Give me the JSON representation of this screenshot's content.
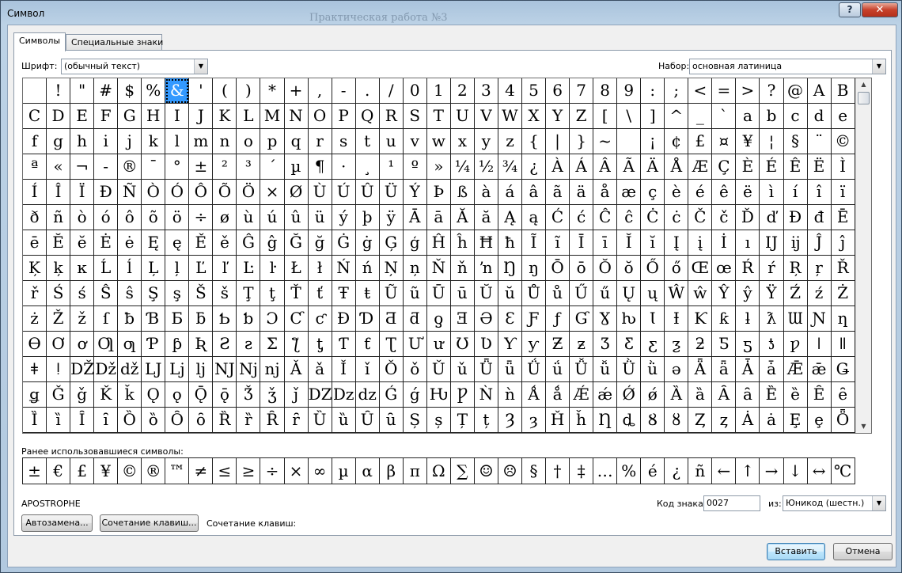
{
  "window": {
    "title": "Символ",
    "background_title": "Практическая работа №3",
    "help": "?",
    "close": "✕"
  },
  "tabs": [
    {
      "label": "Символы"
    },
    {
      "label": "Специальные знаки"
    }
  ],
  "font": {
    "label": "Шрифт:",
    "value": "(обычный текст)"
  },
  "subset": {
    "label": "Набор:",
    "value": "основная латиница"
  },
  "grid": {
    "selected_index": 6,
    "rows": [
      [
        " ",
        "!",
        "\"",
        "#",
        "$",
        "%",
        "&",
        "'",
        "(",
        ")",
        "*",
        "+",
        ",",
        "-",
        ".",
        "/",
        "0",
        "1",
        "2",
        "3",
        "4",
        "5",
        "6",
        "7",
        "8",
        "9",
        ":",
        ";",
        "<",
        "=",
        ">",
        "?",
        "@",
        "A",
        "B"
      ],
      [
        "C",
        "D",
        "E",
        "F",
        "G",
        "H",
        "I",
        "J",
        "K",
        "L",
        "M",
        "N",
        "O",
        "P",
        "Q",
        "R",
        "S",
        "T",
        "U",
        "V",
        "W",
        "X",
        "Y",
        "Z",
        "[",
        "\\",
        "]",
        "^",
        "_",
        "`",
        "a",
        "b",
        "c",
        "d",
        "e"
      ],
      [
        "f",
        "g",
        "h",
        "i",
        "j",
        "k",
        "l",
        "m",
        "n",
        "o",
        "p",
        "q",
        "r",
        "s",
        "t",
        "u",
        "v",
        "w",
        "x",
        "y",
        "z",
        "{",
        "|",
        "}",
        "~",
        " ",
        "¡",
        "¢",
        "£",
        "¤",
        "¥",
        "¦",
        "§",
        "¨",
        "©"
      ],
      [
        "ª",
        "«",
        "¬",
        "-",
        "®",
        "¯",
        "°",
        "±",
        "²",
        "³",
        "´",
        "µ",
        "¶",
        "·",
        "¸",
        "¹",
        "º",
        "»",
        "¼",
        "½",
        "¾",
        "¿",
        "À",
        "Á",
        "Â",
        "Ã",
        "Ä",
        "Å",
        "Æ",
        "Ç",
        "È",
        "É",
        "Ê",
        "Ë",
        "Ì"
      ],
      [
        "Í",
        "Î",
        "Ï",
        "Ð",
        "Ñ",
        "Ò",
        "Ó",
        "Ô",
        "Õ",
        "Ö",
        "×",
        "Ø",
        "Ù",
        "Ú",
        "Û",
        "Ü",
        "Ý",
        "Þ",
        "ß",
        "à",
        "á",
        "â",
        "ã",
        "ä",
        "å",
        "æ",
        "ç",
        "è",
        "é",
        "ê",
        "ë",
        "ì",
        "í",
        "î",
        "ï"
      ],
      [
        "ð",
        "ñ",
        "ò",
        "ó",
        "ô",
        "õ",
        "ö",
        "÷",
        "ø",
        "ù",
        "ú",
        "û",
        "ü",
        "ý",
        "þ",
        "ÿ",
        "Ā",
        "ā",
        "Ă",
        "ă",
        "Ą",
        "ą",
        "Ć",
        "ć",
        "Ĉ",
        "ĉ",
        "Ċ",
        "ċ",
        "Č",
        "č",
        "Ď",
        "ď",
        "Đ",
        "đ",
        "Ē"
      ],
      [
        "ē",
        "Ĕ",
        "ĕ",
        "Ė",
        "ė",
        "Ę",
        "ę",
        "Ě",
        "ě",
        "Ĝ",
        "ĝ",
        "Ğ",
        "ğ",
        "Ġ",
        "ġ",
        "Ģ",
        "ģ",
        "Ĥ",
        "ĥ",
        "Ħ",
        "ħ",
        "Ĩ",
        "ĩ",
        "Ī",
        "ī",
        "Ĭ",
        "ĭ",
        "Į",
        "į",
        "İ",
        "ı",
        "Ĳ",
        "ĳ",
        "Ĵ",
        "ĵ"
      ],
      [
        "Ķ",
        "ķ",
        "ĸ",
        "Ĺ",
        "ĺ",
        "Ļ",
        "ļ",
        "Ľ",
        "ľ",
        "Ŀ",
        "ŀ",
        "Ł",
        "ł",
        "Ń",
        "ń",
        "Ņ",
        "ņ",
        "Ň",
        "ň",
        "ŉ",
        "Ŋ",
        "ŋ",
        "Ō",
        "ō",
        "Ŏ",
        "ŏ",
        "Ő",
        "ő",
        "Œ",
        "œ",
        "Ŕ",
        "ŕ",
        "Ŗ",
        "ŗ",
        "Ř"
      ],
      [
        "ř",
        "Ś",
        "ś",
        "Ŝ",
        "ŝ",
        "Ş",
        "ş",
        "Š",
        "š",
        "Ţ",
        "ţ",
        "Ť",
        "ť",
        "Ŧ",
        "ŧ",
        "Ũ",
        "ũ",
        "Ū",
        "ū",
        "Ŭ",
        "ŭ",
        "Ů",
        "ů",
        "Ű",
        "ű",
        "Ų",
        "ų",
        "Ŵ",
        "ŵ",
        "Ŷ",
        "ŷ",
        "Ÿ",
        "Ź",
        "ź",
        "Ż"
      ],
      [
        "ż",
        "Ž",
        "ž",
        "ſ",
        "ƀ",
        "Ɓ",
        "Ƃ",
        "ƃ",
        "Ƅ",
        "ƅ",
        "Ɔ",
        "Ƈ",
        "ƈ",
        "Ɖ",
        "Ɗ",
        "Ƌ",
        "ƌ",
        "ƍ",
        "Ǝ",
        "Ə",
        "Ɛ",
        "Ƒ",
        "ƒ",
        "Ɠ",
        "Ɣ",
        "ƕ",
        "Ɩ",
        "Ɨ",
        "Ƙ",
        "ƙ",
        "ƚ",
        "ƛ",
        "Ɯ",
        "Ɲ",
        "ƞ"
      ],
      [
        "Ɵ",
        "Ơ",
        "ơ",
        "Ƣ",
        "ƣ",
        "Ƥ",
        "ƥ",
        "Ʀ",
        "Ƨ",
        "ƨ",
        "Ʃ",
        "ƪ",
        "ƫ",
        "Ƭ",
        "ƭ",
        "Ʈ",
        "Ư",
        "ư",
        "Ʊ",
        "Ʋ",
        "Ƴ",
        "ƴ",
        "Ƶ",
        "ƶ",
        "Ʒ",
        "Ƹ",
        "ƹ",
        "ƺ",
        "ƻ",
        "Ƽ",
        "ƽ",
        "ƾ",
        "ƿ",
        "ǀ",
        "ǁ"
      ],
      [
        "ǂ",
        "ǃ",
        "Ǆ",
        "ǅ",
        "ǆ",
        "Ǉ",
        "ǈ",
        "ǉ",
        "Ǌ",
        "ǋ",
        "ǌ",
        "Ǎ",
        "ǎ",
        "Ǐ",
        "ǐ",
        "Ǒ",
        "ǒ",
        "Ǔ",
        "ǔ",
        "Ǖ",
        "ǖ",
        "Ǘ",
        "ǘ",
        "Ǚ",
        "ǚ",
        "Ǜ",
        "ǜ",
        "ǝ",
        "Ǟ",
        "ǟ",
        "Ǡ",
        "ǡ",
        "Ǣ",
        "ǣ",
        "Ǥ"
      ],
      [
        "ǥ",
        "Ǧ",
        "ǧ",
        "Ǩ",
        "ǩ",
        "Ǫ",
        "ǫ",
        "Ǭ",
        "ǭ",
        "Ǯ",
        "ǯ",
        "ǰ",
        "Ǳ",
        "ǲ",
        "ǳ",
        "Ǵ",
        "ǵ",
        "Ƕ",
        "Ƿ",
        "Ǹ",
        "ǹ",
        "Ǻ",
        "ǻ",
        "Ǽ",
        "ǽ",
        "Ǿ",
        "ǿ",
        "Ȁ",
        "ȁ",
        "Ȃ",
        "ȃ",
        "Ȅ",
        "ȅ",
        "Ȇ",
        "ȇ"
      ],
      [
        "Ȉ",
        "ȉ",
        "Ȋ",
        "ȋ",
        "Ȍ",
        "ȍ",
        "Ȏ",
        "ȏ",
        "Ȑ",
        "ȑ",
        "Ȓ",
        "ȓ",
        "Ȕ",
        "ȕ",
        "Ȗ",
        "ȗ",
        "Ș",
        "ș",
        "Ț",
        "ț",
        "Ȝ",
        "ȝ",
        "Ȟ",
        "ȟ",
        "Ƞ",
        "ȡ",
        "Ȣ",
        "ȣ",
        "Ȥ",
        "ȥ",
        "Ȧ",
        "ȧ",
        "Ȩ",
        "ȩ",
        "Ȫ"
      ]
    ]
  },
  "recent": {
    "label": "Ранее использовавшиеся символы:",
    "symbols": [
      "±",
      "€",
      "£",
      "¥",
      "©",
      "®",
      "™",
      "≠",
      "≤",
      "≥",
      "÷",
      "×",
      "∞",
      "µ",
      "α",
      "β",
      "π",
      "Ω",
      "∑",
      "☺",
      "☹",
      "§",
      "†",
      "‡",
      "…",
      "%",
      "é",
      "¿",
      "ñ",
      "←",
      "↑",
      "→",
      "↓",
      "↔",
      "℃"
    ]
  },
  "char_name": "APOSTROPHE",
  "code": {
    "label": "Код знака:",
    "value": "0027",
    "from_label": "из:",
    "from_value": "Юникод (шестн.)"
  },
  "buttons": {
    "autocorrect": "Автозамена...",
    "shortcut_key": "Сочетание клавиш...",
    "shortcut_label": "Сочетание клавиш:",
    "insert": "Вставить",
    "cancel": "Отмена"
  }
}
